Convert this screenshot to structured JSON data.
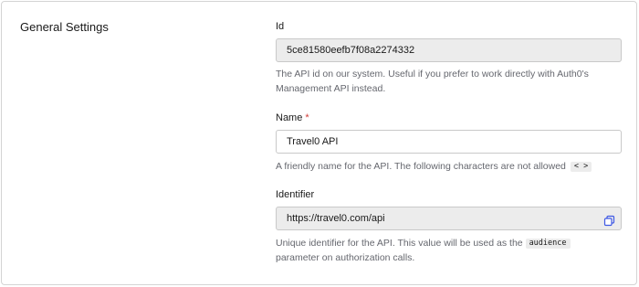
{
  "section": {
    "title": "General Settings"
  },
  "id_field": {
    "label": "Id",
    "value": "5ce81580eefb7f08a2274332",
    "help": "The API id on our system. Useful if you prefer to work directly with Auth0's Management API instead."
  },
  "name_field": {
    "label": "Name",
    "required_marker": "*",
    "value": "Travel0 API",
    "help": "A friendly name for the API. The following characters are not allowed",
    "disallowed_chars": "< >"
  },
  "identifier_field": {
    "label": "Identifier",
    "value": "https://travel0.com/api",
    "copy_icon": "copy-icon",
    "help_prefix": "Unique identifier for the API. This value will be used as the",
    "help_code": "audience",
    "help_suffix": "parameter on authorization calls."
  },
  "colors": {
    "required": "#d03c38",
    "copy_icon": "#3f59e4",
    "readonly_bg": "#ececec"
  }
}
